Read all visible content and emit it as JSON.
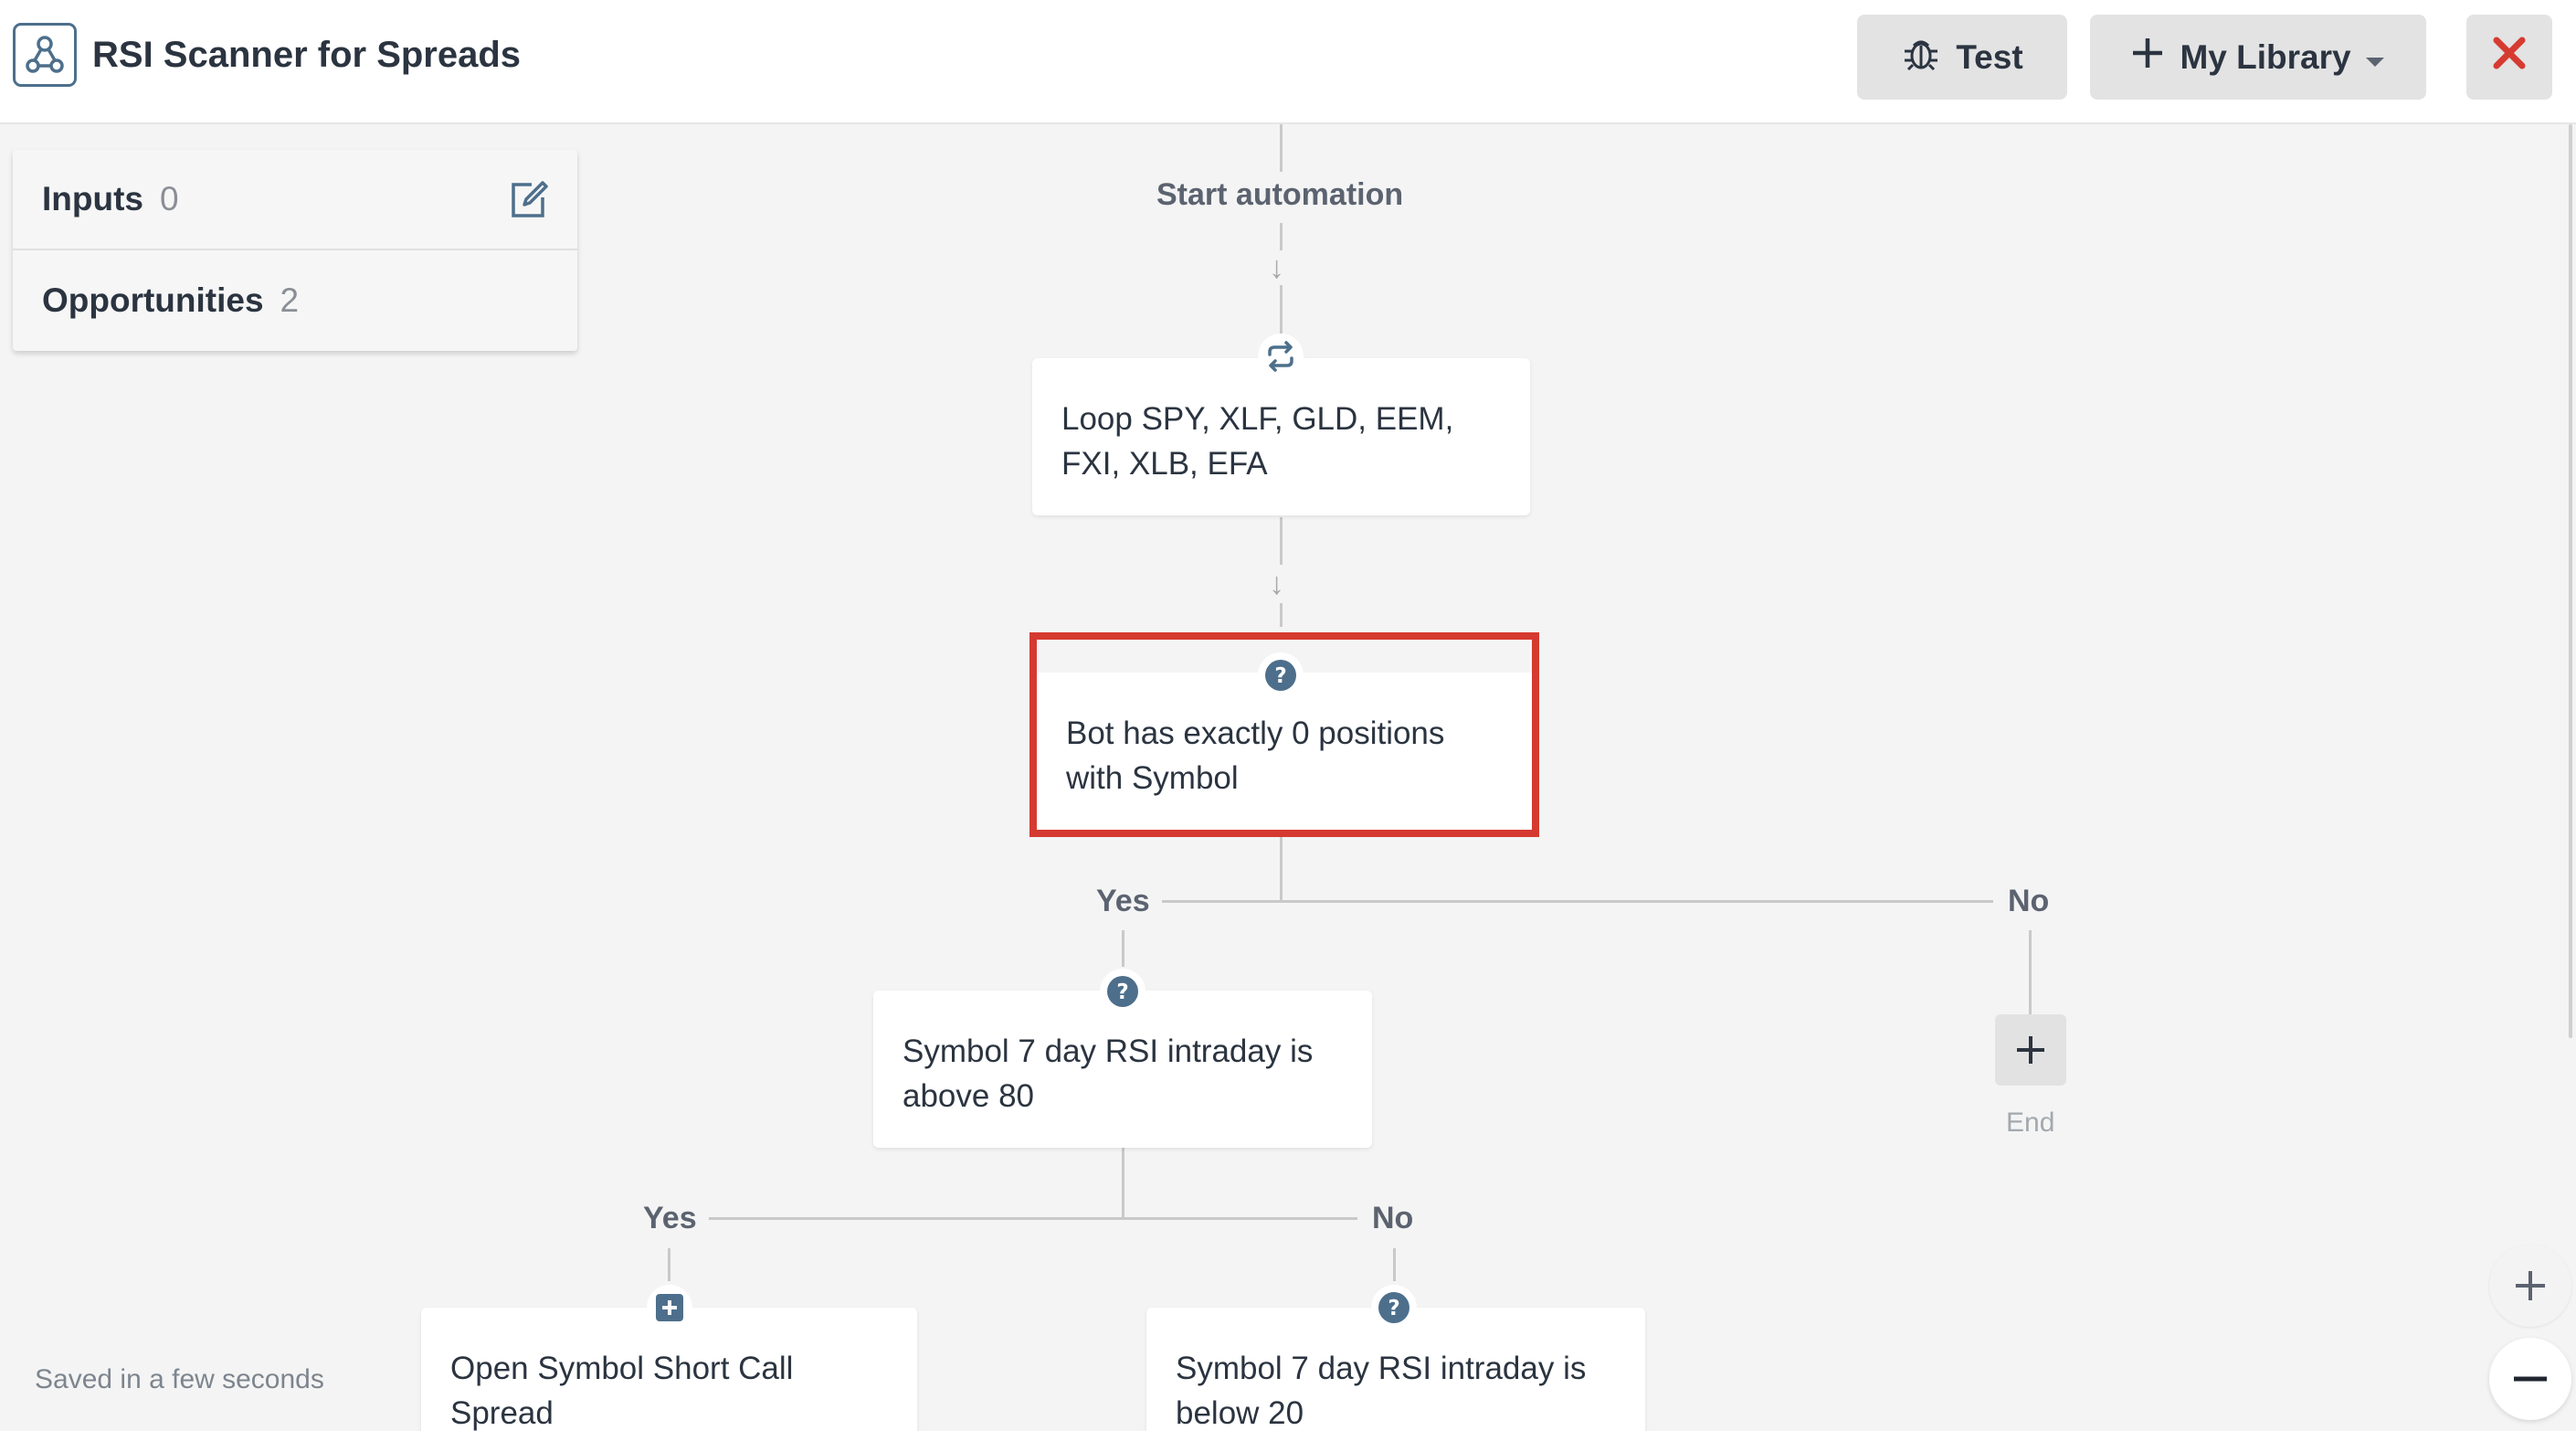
{
  "app": {
    "title": "RSI Scanner for Spreads",
    "logo_icon": "workflow-icon"
  },
  "toolbar": {
    "test_label": "Test",
    "test_icon": "bug-icon",
    "library_label": "My Library",
    "library_icon": "plus-icon",
    "library_caret_icon": "caret-down-icon",
    "close_icon": "close-icon",
    "close_color": "#d63b31"
  },
  "side_panel": {
    "inputs_label": "Inputs",
    "inputs_count": "0",
    "opportunities_label": "Opportunities",
    "opportunities_count": "2",
    "edit_icon": "edit-icon"
  },
  "flow": {
    "start_label": "Start automation",
    "nodes": [
      {
        "id": "loop",
        "icon": "loop-icon",
        "text": "Loop SPY, XLF, GLD, EEM, FXI, XLB, EFA"
      },
      {
        "id": "condition-positions",
        "icon": "question-icon",
        "text": "Bot has exactly 0 positions with Symbol",
        "highlighted": true
      },
      {
        "id": "condition-rsi-above",
        "icon": "question-icon",
        "text": "Symbol 7 day RSI intraday is above 80"
      },
      {
        "id": "action-open-spread",
        "icon": "plus-square-icon",
        "text": "Open Symbol Short Call Spread"
      },
      {
        "id": "condition-rsi-below",
        "icon": "question-icon",
        "text": "Symbol 7 day RSI intraday is below 20"
      }
    ],
    "branches": {
      "positions_yes": "Yes",
      "positions_no": "No",
      "rsi_yes": "Yes",
      "rsi_no": "No"
    },
    "end_label": "End",
    "highlight_color": "#d53a30",
    "icon_color": "#4d6f8c"
  },
  "status": {
    "saved_text": "Saved in a few seconds"
  },
  "zoom": {
    "in_icon": "zoom-in-icon",
    "out_icon": "zoom-out-icon"
  }
}
